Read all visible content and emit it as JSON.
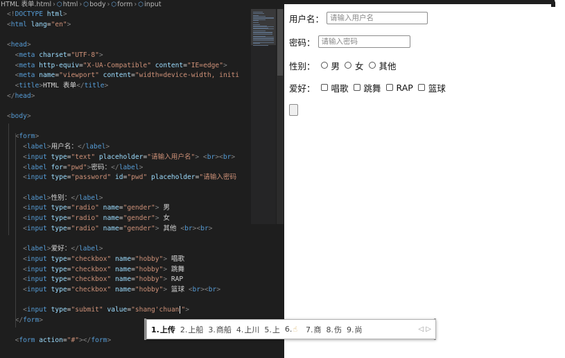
{
  "breadcrumb": {
    "file": "HTML 表单.html",
    "items": [
      "html",
      "body",
      "form",
      "input"
    ]
  },
  "editor": {
    "lines": [
      [
        [
          "punc",
          "<!"
        ],
        [
          "tag",
          "DOCTYPE"
        ],
        [
          "txt",
          " "
        ],
        [
          "attr",
          "html"
        ],
        [
          "punc",
          ">"
        ]
      ],
      [
        [
          "punc",
          "<"
        ],
        [
          "tag",
          "html"
        ],
        [
          "txt",
          " "
        ],
        [
          "attr",
          "lang"
        ],
        [
          "txt",
          "="
        ],
        [
          "str",
          "\"en\""
        ],
        [
          "punc",
          ">"
        ]
      ],
      [],
      [
        [
          "punc",
          "<"
        ],
        [
          "tag",
          "head"
        ],
        [
          "punc",
          ">"
        ]
      ],
      [
        [
          "txt",
          "  "
        ],
        [
          "punc",
          "<"
        ],
        [
          "tag",
          "meta"
        ],
        [
          "txt",
          " "
        ],
        [
          "attr",
          "charset"
        ],
        [
          "txt",
          "="
        ],
        [
          "str",
          "\"UTF-8\""
        ],
        [
          "punc",
          ">"
        ]
      ],
      [
        [
          "txt",
          "  "
        ],
        [
          "punc",
          "<"
        ],
        [
          "tag",
          "meta"
        ],
        [
          "txt",
          " "
        ],
        [
          "attr",
          "http-equiv"
        ],
        [
          "txt",
          "="
        ],
        [
          "str",
          "\"X-UA-Compatible\""
        ],
        [
          "txt",
          " "
        ],
        [
          "attr",
          "content"
        ],
        [
          "txt",
          "="
        ],
        [
          "str",
          "\"IE=edge\""
        ],
        [
          "punc",
          ">"
        ]
      ],
      [
        [
          "txt",
          "  "
        ],
        [
          "punc",
          "<"
        ],
        [
          "tag",
          "meta"
        ],
        [
          "txt",
          " "
        ],
        [
          "attr",
          "name"
        ],
        [
          "txt",
          "="
        ],
        [
          "str",
          "\"viewport\""
        ],
        [
          "txt",
          " "
        ],
        [
          "attr",
          "content"
        ],
        [
          "txt",
          "="
        ],
        [
          "str",
          "\"width=device-width, initi"
        ]
      ],
      [
        [
          "txt",
          "  "
        ],
        [
          "punc",
          "<"
        ],
        [
          "tag",
          "title"
        ],
        [
          "punc",
          ">"
        ],
        [
          "txt",
          "HTML 表单"
        ],
        [
          "punc",
          "</"
        ],
        [
          "tag",
          "title"
        ],
        [
          "punc",
          ">"
        ]
      ],
      [
        [
          "punc",
          "</"
        ],
        [
          "tag",
          "head"
        ],
        [
          "punc",
          ">"
        ]
      ],
      [],
      [
        [
          "punc",
          "<"
        ],
        [
          "tag",
          "body"
        ],
        [
          "punc",
          ">"
        ]
      ],
      [],
      [
        [
          "txt",
          "  "
        ],
        [
          "punc",
          "<"
        ],
        [
          "tag",
          "form"
        ],
        [
          "punc",
          ">"
        ]
      ],
      [
        [
          "txt",
          "    "
        ],
        [
          "punc",
          "<"
        ],
        [
          "tag",
          "label"
        ],
        [
          "punc",
          ">"
        ],
        [
          "txt",
          "用户名："
        ],
        [
          "punc",
          "</"
        ],
        [
          "tag",
          "label"
        ],
        [
          "punc",
          ">"
        ]
      ],
      [
        [
          "txt",
          "    "
        ],
        [
          "punc",
          "<"
        ],
        [
          "tag",
          "input"
        ],
        [
          "txt",
          " "
        ],
        [
          "attr",
          "type"
        ],
        [
          "txt",
          "="
        ],
        [
          "str",
          "\"text\""
        ],
        [
          "txt",
          " "
        ],
        [
          "attr",
          "placeholder"
        ],
        [
          "txt",
          "="
        ],
        [
          "str",
          "\"请输入用户名\""
        ],
        [
          "punc",
          ">"
        ],
        [
          "txt",
          " "
        ],
        [
          "punc",
          "<"
        ],
        [
          "tag",
          "br"
        ],
        [
          "punc",
          ">"
        ],
        [
          "punc",
          "<"
        ],
        [
          "tag",
          "br"
        ],
        [
          "punc",
          ">"
        ]
      ],
      [
        [
          "txt",
          "    "
        ],
        [
          "punc",
          "<"
        ],
        [
          "tag",
          "label"
        ],
        [
          "txt",
          " "
        ],
        [
          "attr",
          "for"
        ],
        [
          "txt",
          "="
        ],
        [
          "str",
          "\"pwd\""
        ],
        [
          "punc",
          ">"
        ],
        [
          "txt",
          "密码："
        ],
        [
          "punc",
          "</"
        ],
        [
          "tag",
          "label"
        ],
        [
          "punc",
          ">"
        ]
      ],
      [
        [
          "txt",
          "    "
        ],
        [
          "punc",
          "<"
        ],
        [
          "tag",
          "input"
        ],
        [
          "txt",
          " "
        ],
        [
          "attr",
          "type"
        ],
        [
          "txt",
          "="
        ],
        [
          "str",
          "\"password\""
        ],
        [
          "txt",
          " "
        ],
        [
          "attr",
          "id"
        ],
        [
          "txt",
          "="
        ],
        [
          "str",
          "\"pwd\""
        ],
        [
          "txt",
          " "
        ],
        [
          "attr",
          "placeholder"
        ],
        [
          "txt",
          "="
        ],
        [
          "str",
          "\"请输入密码"
        ]
      ],
      [],
      [
        [
          "txt",
          "    "
        ],
        [
          "punc",
          "<"
        ],
        [
          "tag",
          "label"
        ],
        [
          "punc",
          ">"
        ],
        [
          "txt",
          "性别："
        ],
        [
          "punc",
          "</"
        ],
        [
          "tag",
          "label"
        ],
        [
          "punc",
          ">"
        ]
      ],
      [
        [
          "txt",
          "    "
        ],
        [
          "punc",
          "<"
        ],
        [
          "tag",
          "input"
        ],
        [
          "txt",
          " "
        ],
        [
          "attr",
          "type"
        ],
        [
          "txt",
          "="
        ],
        [
          "str",
          "\"radio\""
        ],
        [
          "txt",
          " "
        ],
        [
          "attr",
          "name"
        ],
        [
          "txt",
          "="
        ],
        [
          "str",
          "\"gender\""
        ],
        [
          "punc",
          ">"
        ],
        [
          "txt",
          " 男"
        ]
      ],
      [
        [
          "txt",
          "    "
        ],
        [
          "punc",
          "<"
        ],
        [
          "tag",
          "input"
        ],
        [
          "txt",
          " "
        ],
        [
          "attr",
          "type"
        ],
        [
          "txt",
          "="
        ],
        [
          "str",
          "\"radio\""
        ],
        [
          "txt",
          " "
        ],
        [
          "attr",
          "name"
        ],
        [
          "txt",
          "="
        ],
        [
          "str",
          "\"gender\""
        ],
        [
          "punc",
          ">"
        ],
        [
          "txt",
          " 女"
        ]
      ],
      [
        [
          "txt",
          "    "
        ],
        [
          "punc",
          "<"
        ],
        [
          "tag",
          "input"
        ],
        [
          "txt",
          " "
        ],
        [
          "attr",
          "type"
        ],
        [
          "txt",
          "="
        ],
        [
          "str",
          "\"radio\""
        ],
        [
          "txt",
          " "
        ],
        [
          "attr",
          "name"
        ],
        [
          "txt",
          "="
        ],
        [
          "str",
          "\"gender\""
        ],
        [
          "punc",
          ">"
        ],
        [
          "txt",
          " 其他 "
        ],
        [
          "punc",
          "<"
        ],
        [
          "tag",
          "br"
        ],
        [
          "punc",
          ">"
        ],
        [
          "punc",
          "<"
        ],
        [
          "tag",
          "br"
        ],
        [
          "punc",
          ">"
        ]
      ],
      [],
      [
        [
          "txt",
          "    "
        ],
        [
          "punc",
          "<"
        ],
        [
          "tag",
          "label"
        ],
        [
          "punc",
          ">"
        ],
        [
          "txt",
          "爱好："
        ],
        [
          "punc",
          "</"
        ],
        [
          "tag",
          "label"
        ],
        [
          "punc",
          ">"
        ]
      ],
      [
        [
          "txt",
          "    "
        ],
        [
          "punc",
          "<"
        ],
        [
          "tag",
          "input"
        ],
        [
          "txt",
          " "
        ],
        [
          "attr",
          "type"
        ],
        [
          "txt",
          "="
        ],
        [
          "str",
          "\"checkbox\""
        ],
        [
          "txt",
          " "
        ],
        [
          "attr",
          "name"
        ],
        [
          "txt",
          "="
        ],
        [
          "str",
          "\"hobby\""
        ],
        [
          "punc",
          ">"
        ],
        [
          "txt",
          " 唱歌"
        ]
      ],
      [
        [
          "txt",
          "    "
        ],
        [
          "punc",
          "<"
        ],
        [
          "tag",
          "input"
        ],
        [
          "txt",
          " "
        ],
        [
          "attr",
          "type"
        ],
        [
          "txt",
          "="
        ],
        [
          "str",
          "\"checkbox\""
        ],
        [
          "txt",
          " "
        ],
        [
          "attr",
          "name"
        ],
        [
          "txt",
          "="
        ],
        [
          "str",
          "\"hobby\""
        ],
        [
          "punc",
          ">"
        ],
        [
          "txt",
          " 跳舞"
        ]
      ],
      [
        [
          "txt",
          "    "
        ],
        [
          "punc",
          "<"
        ],
        [
          "tag",
          "input"
        ],
        [
          "txt",
          " "
        ],
        [
          "attr",
          "type"
        ],
        [
          "txt",
          "="
        ],
        [
          "str",
          "\"checkbox\""
        ],
        [
          "txt",
          " "
        ],
        [
          "attr",
          "name"
        ],
        [
          "txt",
          "="
        ],
        [
          "str",
          "\"hobby\""
        ],
        [
          "punc",
          ">"
        ],
        [
          "txt",
          " RAP"
        ]
      ],
      [
        [
          "txt",
          "    "
        ],
        [
          "punc",
          "<"
        ],
        [
          "tag",
          "input"
        ],
        [
          "txt",
          " "
        ],
        [
          "attr",
          "type"
        ],
        [
          "txt",
          "="
        ],
        [
          "str",
          "\"checkbox\""
        ],
        [
          "txt",
          " "
        ],
        [
          "attr",
          "name"
        ],
        [
          "txt",
          "="
        ],
        [
          "str",
          "\"hobby\""
        ],
        [
          "punc",
          ">"
        ],
        [
          "txt",
          " 篮球 "
        ],
        [
          "punc",
          "<"
        ],
        [
          "tag",
          "br"
        ],
        [
          "punc",
          ">"
        ],
        [
          "punc",
          "<"
        ],
        [
          "tag",
          "br"
        ],
        [
          "punc",
          ">"
        ]
      ],
      [],
      [
        [
          "txt",
          "    "
        ],
        [
          "punc",
          "<"
        ],
        [
          "tag",
          "input"
        ],
        [
          "txt",
          " "
        ],
        [
          "attr",
          "type"
        ],
        [
          "txt",
          "="
        ],
        [
          "str",
          "\"submit\""
        ],
        [
          "txt",
          " "
        ],
        [
          "attr",
          "value"
        ],
        [
          "txt",
          "="
        ],
        [
          "str",
          "\"shang'chuan"
        ],
        [
          "caret",
          ""
        ],
        [
          "str",
          "\""
        ],
        [
          "punc",
          ">"
        ]
      ],
      [
        [
          "txt",
          "  "
        ],
        [
          "punc",
          "</"
        ],
        [
          "tag",
          "form"
        ],
        [
          "punc",
          ">"
        ]
      ],
      [],
      [
        [
          "txt",
          "  "
        ],
        [
          "punc",
          "<"
        ],
        [
          "tag",
          "form"
        ],
        [
          "txt",
          " "
        ],
        [
          "attr",
          "action"
        ],
        [
          "txt",
          "="
        ],
        [
          "str",
          "\"#\""
        ],
        [
          "punc",
          ">"
        ],
        [
          "punc",
          "</"
        ],
        [
          "tag",
          "form"
        ],
        [
          "punc",
          ">"
        ]
      ]
    ]
  },
  "preview": {
    "username_label": "用户名：",
    "username_placeholder": "请输入用户名",
    "password_label": "密码：",
    "password_placeholder": "请输入密码",
    "gender_label": "性别：",
    "gender_options": [
      "男",
      "女",
      "其他"
    ],
    "hobby_label": "爱好：",
    "hobby_options": [
      "唱歌",
      "跳舞",
      "RAP",
      "篮球"
    ]
  },
  "ime": {
    "candidates": [
      {
        "num": "1.",
        "text": "上传"
      },
      {
        "num": "2.",
        "text": "上船"
      },
      {
        "num": "3.",
        "text": "商船"
      },
      {
        "num": "4.",
        "text": "上川"
      },
      {
        "num": "5.",
        "text": "上"
      },
      {
        "num": "6.",
        "text": ""
      },
      {
        "num": "7.",
        "text": "商"
      },
      {
        "num": "8.",
        "text": "伤"
      },
      {
        "num": "9.",
        "text": "尚"
      }
    ],
    "arrows": "◁ ▷"
  },
  "icons": {
    "breadcrumb_element": "cube-icon",
    "breadcrumb_separator": "chevron-right-icon",
    "ime_cursor": "hand-pointer-icon"
  },
  "colors": {
    "tag": "#569cd6",
    "attr": "#9cdcfe",
    "string": "#ce9178",
    "punctuation": "#808080",
    "editor_bg": "#1e1e1e"
  }
}
